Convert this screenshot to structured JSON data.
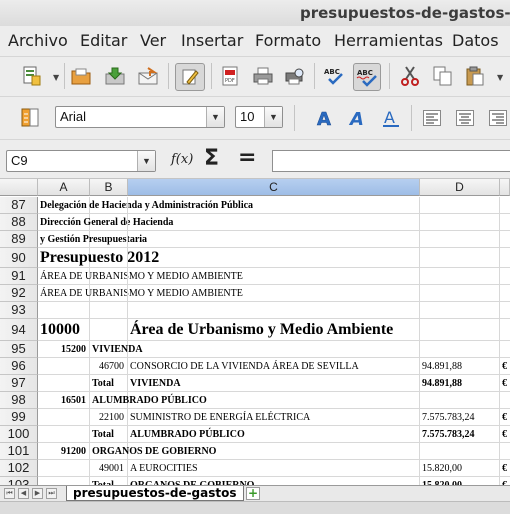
{
  "window": {
    "title": "presupuestos-de-gastos-"
  },
  "menu": [
    "Archivo",
    "Editar",
    "Ver",
    "Insertar",
    "Formato",
    "Herramientas",
    "Datos"
  ],
  "toolbar1": {
    "icons": [
      "new-document-icon",
      "open-folder-icon",
      "save-icon",
      "send-email-icon",
      "edit-mode-icon",
      "export-pdf-icon",
      "print-icon",
      "print-preview-icon",
      "spellcheck-icon",
      "autospellcheck-icon",
      "cut-icon",
      "copy-icon",
      "paste-icon"
    ],
    "spell_label": "ABC"
  },
  "toolbar2": {
    "font_name": "Arial",
    "font_size": "10",
    "bold_glyph": "A"
  },
  "formula_bar": {
    "cell_ref": "C9",
    "fx_label": "f(x)",
    "sum_label": "Σ",
    "equals_label": "=",
    "content": ""
  },
  "columns": [
    "A",
    "B",
    "C",
    "D"
  ],
  "rows": [
    {
      "num": "87",
      "a": "Delegación de Hacienda y Administración Pública",
      "b": "",
      "c": "",
      "d": "",
      "e": ""
    },
    {
      "num": "88",
      "a": "Dirección General de Hacienda",
      "b": "",
      "c": "",
      "d": "",
      "e": ""
    },
    {
      "num": "89",
      "a": "y Gestión Presupuestaria",
      "b": "",
      "c": "",
      "d": "",
      "e": ""
    },
    {
      "num": "90",
      "a": "Presupuesto 2012",
      "b": "",
      "c": "",
      "d": "",
      "e": ""
    },
    {
      "num": "91",
      "a": "ÁREA DE URBANISMO Y MEDIO AMBIENTE",
      "b": "",
      "c": "",
      "d": "",
      "e": ""
    },
    {
      "num": "92",
      "a": "ÁREA DE URBANISMO Y MEDIO AMBIENTE",
      "b": "",
      "c": "",
      "d": "",
      "e": ""
    },
    {
      "num": "93",
      "a": "",
      "b": "",
      "c": "",
      "d": "",
      "e": ""
    },
    {
      "num": "94",
      "a": "10000",
      "b": "",
      "c": "Área de Urbanismo y Medio Ambiente",
      "d": "",
      "e": ""
    },
    {
      "num": "95",
      "a": "15200",
      "b": "VIVIENDA",
      "c": "",
      "d": "",
      "e": ""
    },
    {
      "num": "96",
      "a": "",
      "b": "46700",
      "c": "CONSORCIO DE LA VIVIENDA ÁREA DE SEVILLA",
      "d": "94.891,88",
      "e": "€"
    },
    {
      "num": "97",
      "a": "",
      "b": "Total",
      "c": "VIVIENDA",
      "d": "94.891,88",
      "e": "€"
    },
    {
      "num": "98",
      "a": "16501",
      "b": "ALUMBRADO PÚBLICO",
      "c": "",
      "d": "",
      "e": ""
    },
    {
      "num": "99",
      "a": "",
      "b": "22100",
      "c": "SUMINISTRO DE ENERGÍA ELÉCTRICA",
      "d": "7.575.783,24",
      "e": "€"
    },
    {
      "num": "100",
      "a": "",
      "b": "Total",
      "c": "ALUMBRADO PÚBLICO",
      "d": "7.575.783,24",
      "e": "€"
    },
    {
      "num": "101",
      "a": "91200",
      "b": "ORGANOS DE GOBIERNO",
      "c": "",
      "d": "",
      "e": ""
    },
    {
      "num": "102",
      "a": "",
      "b": "49001",
      "c": "A EUROCITIES",
      "d": "15.820,00",
      "e": "€"
    },
    {
      "num": "103",
      "a": "",
      "b": "Total",
      "c": "ORGANOS DE GOBIERNO",
      "d": "15.820,00",
      "e": "€"
    }
  ],
  "sheet_tab": {
    "label": "presupuestos-de-gastos",
    "add_label": "+"
  },
  "colors": {
    "selected_column": "#9ebde6",
    "header": "#e6e6e6",
    "grid": "#d8d8d8"
  }
}
